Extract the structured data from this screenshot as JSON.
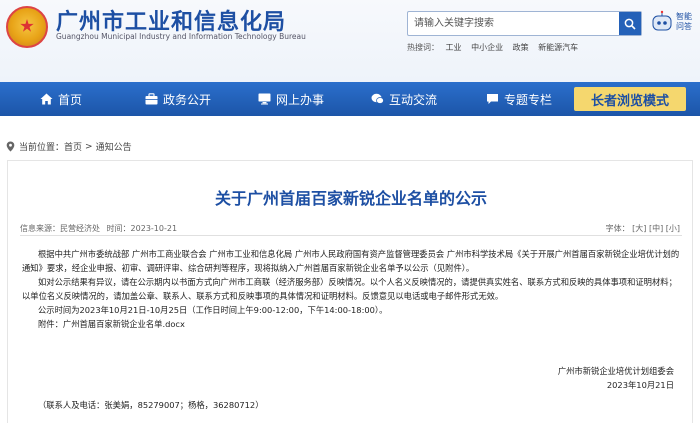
{
  "header": {
    "title": "广州市工业和信息化局",
    "subtitle": "Guangzhou Municipal Industry and Information Technology Bureau",
    "search_placeholder": "请输入关键字搜索",
    "robot_label": "智能问答",
    "hot_label": "热搜词：",
    "hot_words": [
      "工业",
      "中小企业",
      "政策",
      "新能源汽车"
    ]
  },
  "nav": {
    "items": [
      "首页",
      "政务公开",
      "网上办事",
      "互动交流",
      "专题专栏"
    ],
    "elder_mode": "长者浏览模式"
  },
  "breadcrumb": {
    "prefix": "当前位置：",
    "home": "首页",
    "current": "通知公告"
  },
  "article": {
    "title": "关于广州首届百家新锐企业名单的公示",
    "source": "信息来源：民营经济处",
    "time": "时间：2023-10-21",
    "font_label": "字体：",
    "font_sizes": [
      "[大]",
      "[中]",
      "[小]"
    ],
    "paragraphs": [
      "根据中共广州市委统战部 广州市工商业联合会 广州市工业和信息化局 广州市人民政府国有资产监督管理委员会 广州市科学技术局《关于开展广州首届百家新锐企业培优计划的通知》要求，经企业申报、初审、调研评审、综合研判等程序，现将拟纳入广州首届百家新锐企业名单予以公示（见附件）。",
      "如对公示结果有异议，请在公示期内以书面方式向广州市工商联（经济服务部）反映情况。以个人名义反映情况的，请提供真实姓名、联系方式和反映的具体事项和证明材料；以单位名义反映情况的，请加盖公章、联系人、联系方式和反映事项的具体情况和证明材料。反馈意见以电话或电子邮件形式无效。",
      "公示时间为2023年10月21日-10月25日（工作日时间上午9:00-12:00，下午14:00-18:00）。",
      "附件：广州首届百家新锐企业名单.docx"
    ],
    "signer": "广州市新锐企业培优计划组委会",
    "date": "2023年10月21日",
    "contact": "（联系人及电话：张美娟，85279007；杨格，36280712）"
  },
  "colors": {
    "brand_blue": "#1d4fa3",
    "nav_blue": "#2461b8",
    "elder_yellow": "#f5d76e"
  }
}
